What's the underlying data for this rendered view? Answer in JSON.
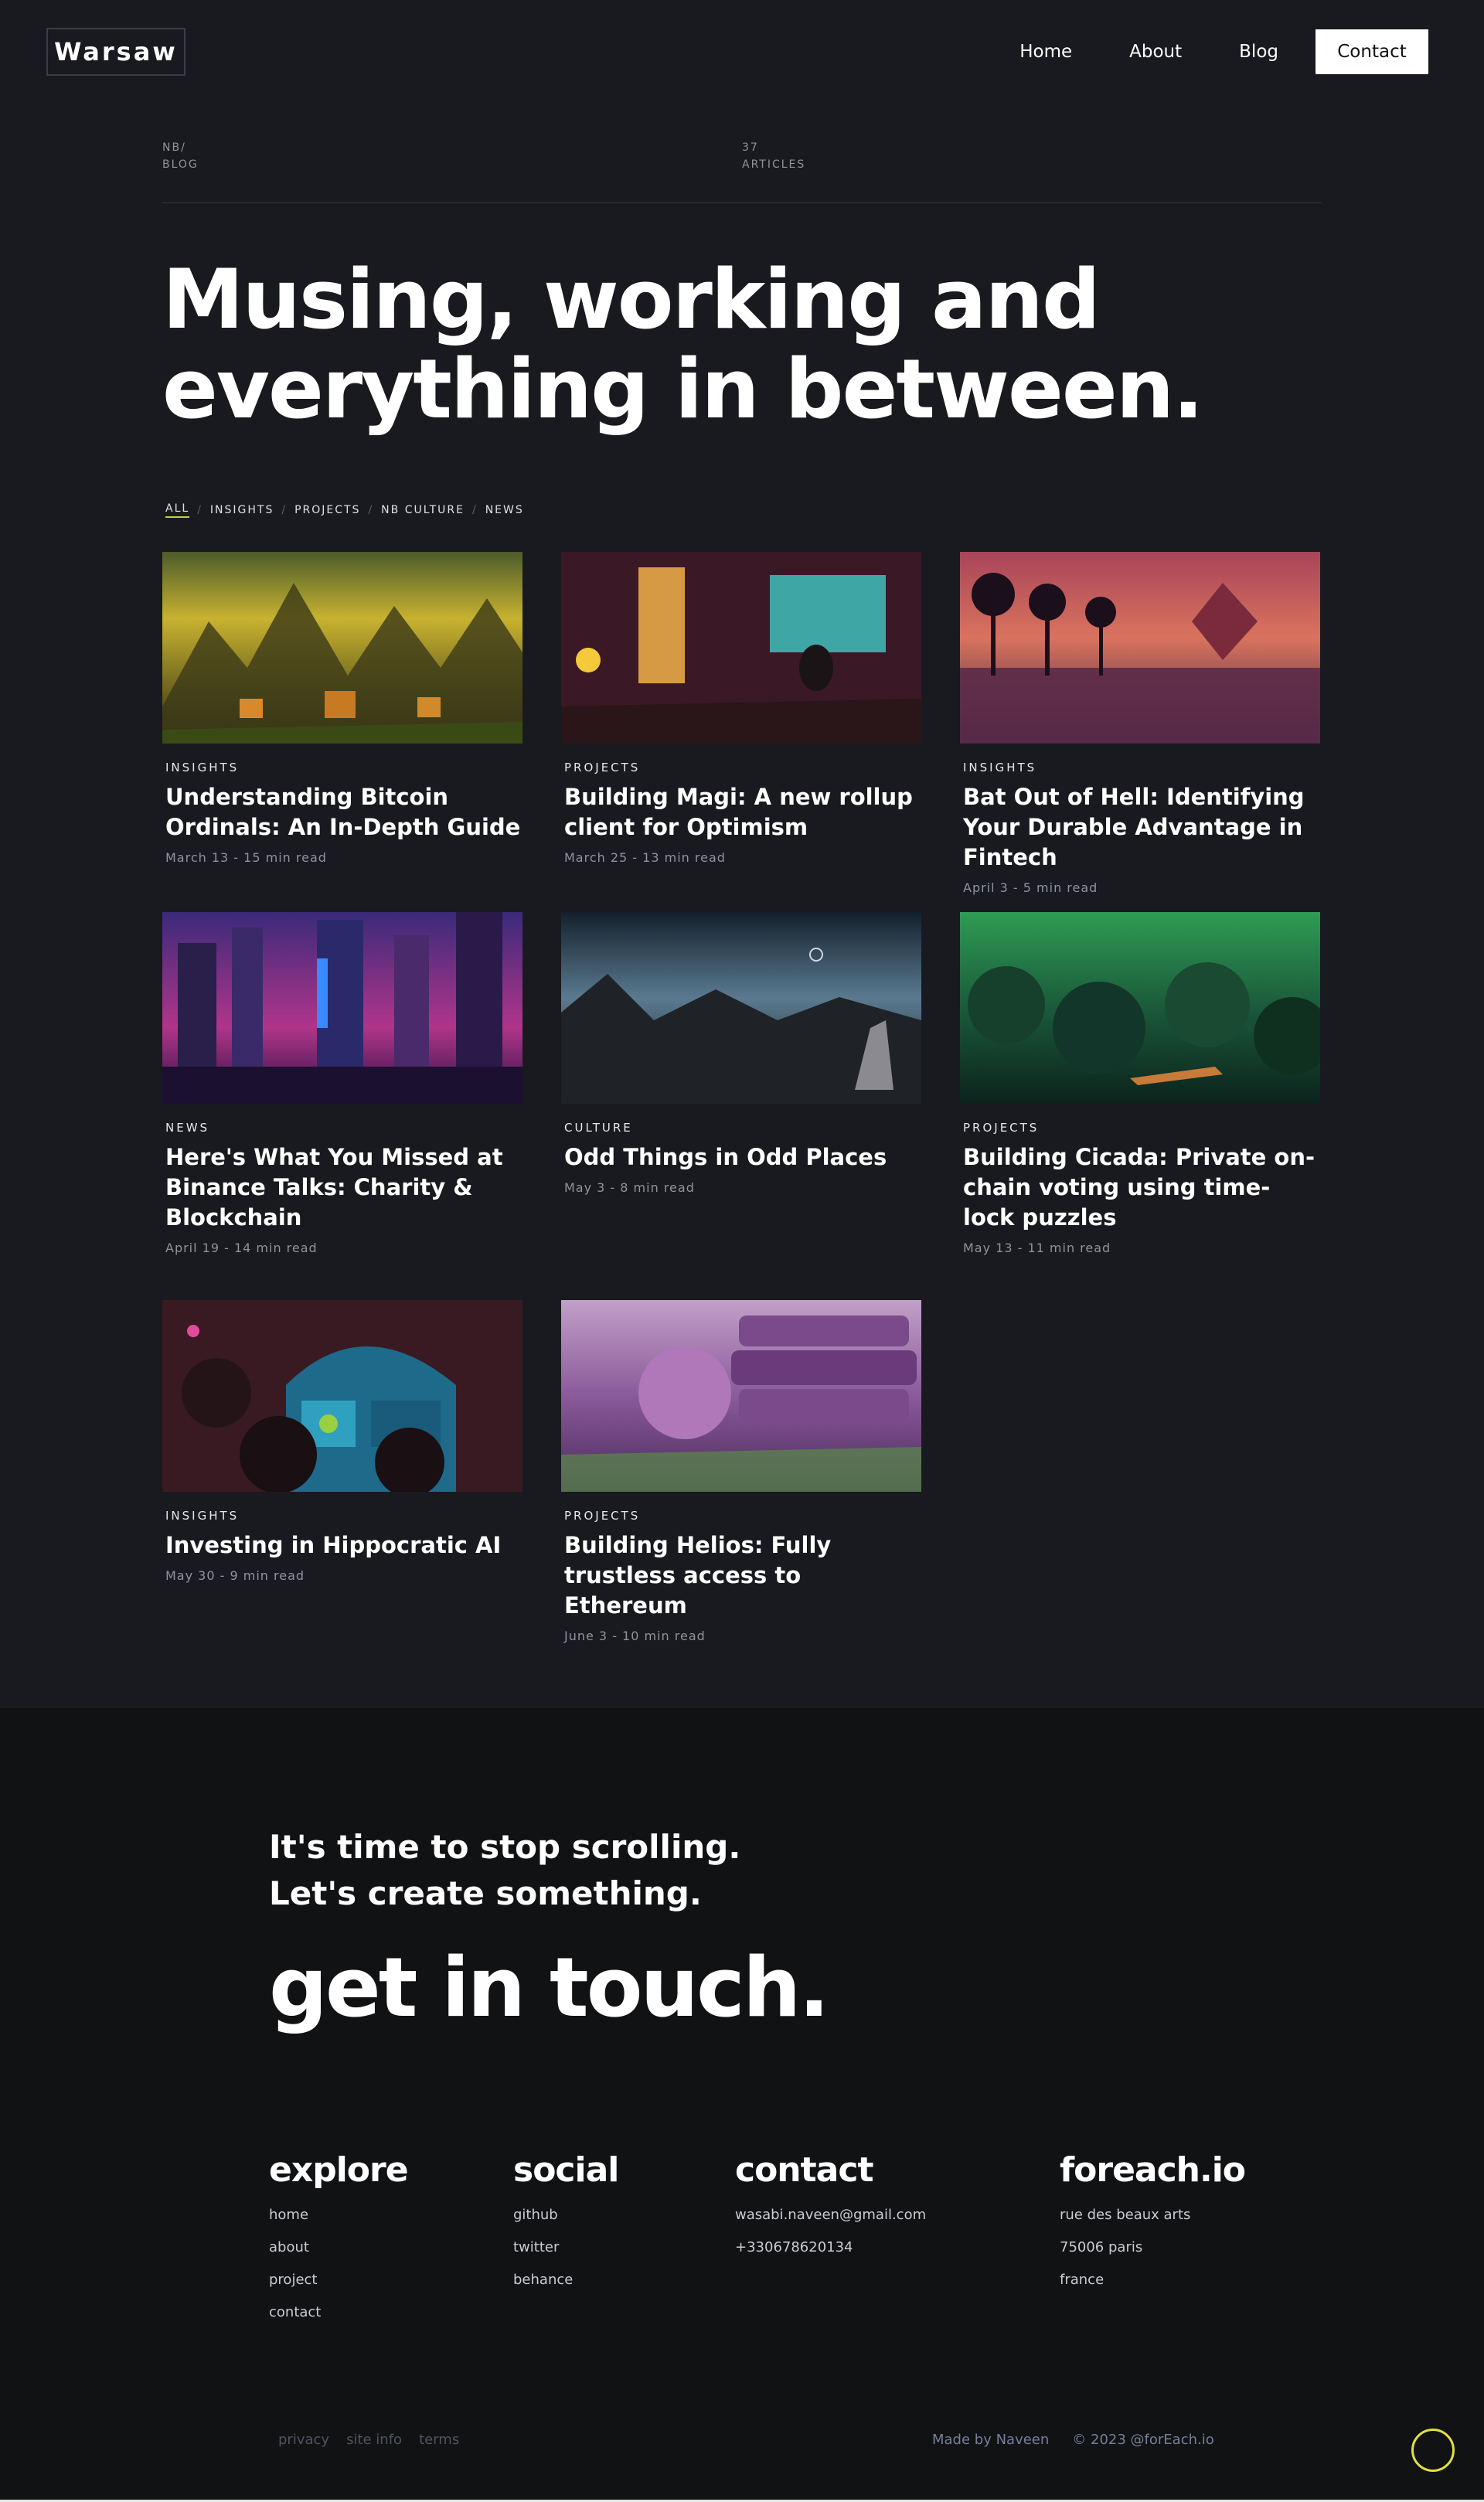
{
  "header": {
    "logo": "Warsaw",
    "nav": [
      "Home",
      "About",
      "Blog",
      "Contact"
    ]
  },
  "meta": {
    "crumb_line1": "NB/",
    "crumb_line2": "BLOG",
    "count": "37",
    "count_label": "ARTICLES"
  },
  "hero": {
    "line1": "Musing, working and",
    "line2": "everything in between."
  },
  "filters": [
    "ALL",
    "INSIGHTS",
    "PROJECTS",
    "NB CULTURE",
    "NEWS"
  ],
  "posts": [
    {
      "category": "INSIGHTS",
      "title": "Understanding Bitcoin Ordinals: An In-Depth Guide",
      "date": "March 13 - 15 min read"
    },
    {
      "category": "PROJECTS",
      "title": "Building Magi: A new rollup client for Optimism",
      "date": "March 25 - 13 min read"
    },
    {
      "category": "INSIGHTS",
      "title": "Bat Out of Hell: Identifying Your Durable Advantage in Fintech",
      "date": "April 3 - 5 min read"
    },
    {
      "category": "NEWS",
      "title": "Here's What You Missed at Binance Talks: Charity & Blockchain",
      "date": "April 19 - 14 min read"
    },
    {
      "category": "CULTURE",
      "title": "Odd Things in Odd Places",
      "date": "May 3 - 8 min read"
    },
    {
      "category": "PROJECTS",
      "title": "Building Cicada: Private on-chain voting using time-lock puzzles",
      "date": "May 13 - 11 min read"
    },
    {
      "category": "INSIGHTS",
      "title": "Investing in Hippocratic AI",
      "date": "May 30 - 9 min read"
    },
    {
      "category": "PROJECTS",
      "title": "Building Helios: Fully trustless access to Ethereum",
      "date": "June 3 - 10 min read"
    }
  ],
  "footer": {
    "tagline1": "It's time to stop scrolling.",
    "tagline2": "Let's create something.",
    "cta": "get in touch.",
    "explore": {
      "title": "explore",
      "items": [
        "home",
        "about",
        "project",
        "contact"
      ]
    },
    "social": {
      "title": "social",
      "items": [
        "github",
        "twitter",
        "behance"
      ]
    },
    "contact": {
      "title": "contact",
      "items": [
        "wasabi.naveen@gmail.com",
        "+330678620134"
      ]
    },
    "foreach": {
      "title": "foreach.io",
      "items": [
        "rue des beaux arts",
        "75006 paris",
        "france"
      ]
    },
    "legal": [
      "privacy",
      "site info",
      "terms"
    ],
    "made_by": "Made by Naveen",
    "copyright": "© 2023 @forEach.io"
  }
}
